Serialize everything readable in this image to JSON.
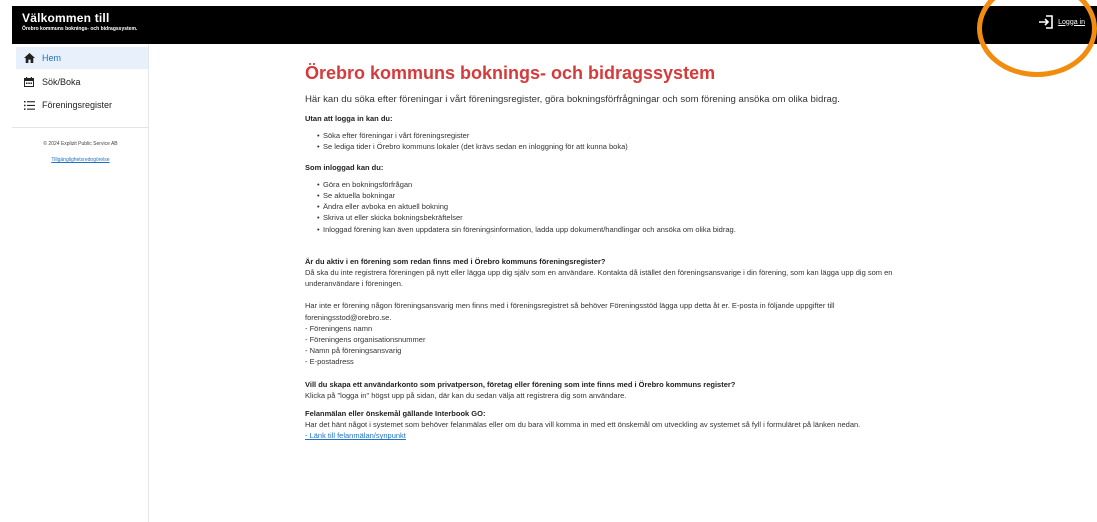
{
  "header": {
    "title": "Välkommen till",
    "subtitle": "Örebro kommuns boknings- och bidragssystem.",
    "login_label": "Logga in",
    "login_icon": "login-icon"
  },
  "colors": {
    "header_bg": "#000000",
    "accent": "#1e70c8",
    "title": "#d63a3a",
    "highlight": "#f28c0f"
  },
  "sidebar": {
    "items": [
      {
        "label": "Hem",
        "icon": "home-icon",
        "active": true
      },
      {
        "label": "Sök/Boka",
        "icon": "calendar-icon",
        "active": false
      },
      {
        "label": "Föreningsregister",
        "icon": "list-icon",
        "active": false
      }
    ],
    "copyright": "© 2024 Explizit Public Service AB",
    "privacy_link": "Tillgänglighetsredogörelse"
  },
  "main": {
    "title": "Örebro kommuns boknings- och bidragssystem",
    "intro": "Här kan du söka efter föreningar i vårt föreningsregister, göra bokningsförfrågningar och som förening ansöka om olika bidrag.",
    "without_login_heading": "Utan att logga in kan du:",
    "without_login_items": [
      "Söka efter föreningar i vårt föreningsregister",
      "Se lediga tider i Örebro kommuns lokaler (det krävs sedan en inloggning för att kunna boka)"
    ],
    "logged_in_heading": "Som inloggad kan du:",
    "logged_in_items": [
      "Göra en bokningsförfrågan",
      "Se aktuella bokningar",
      "Ändra eller avboka en aktuell bokning",
      "Skriva ut eller skicka bokningsbekräftelser",
      "Inloggad förening kan även uppdatera sin föreningsinformation, ladda upp dokument/handlingar och ansöka om olika bidrag."
    ],
    "active_heading": "Är du aktiv i en förening som redan finns med i Örebro kommuns föreningsregister?",
    "active_text": "Då ska du inte registrera föreningen på nytt eller lägga upp dig själv som en användare. Kontakta då istället den föreningsansvarige i din förening, som kan lägga upp dig som en underanvändare i föreningen.",
    "no_contact_text": "Har inte er förening någon föreningsansvarig men finns med i föreningsregistret så behöver Föreningsstöd lägga upp detta åt er. E-posta in följande uppgifter till foreningsstod@orebro.se.",
    "details_lines": [
      "- Föreningens namn",
      "- Föreningens organisationsnummer",
      "- Namn på föreningsansvarig",
      "- E-postadress"
    ],
    "create_heading": "Vill du skapa ett användarkonto som privatperson, företag eller förening som inte finns med i Örebro kommuns register?",
    "create_text": "Klicka på \"logga in\" högst upp på sidan, där kan du sedan välja att registrera dig som användare.",
    "report_heading": "Felanmälan eller önskemål gällande Interbook GO:",
    "report_text": "Har det hänt något i systemet som behöver felanmälas eller om du bara vill komma in med ett önskemål om utveckling av systemet så fyll i formuläret på länken nedan.",
    "report_link": "- Länk till felanmälan/synpunkt"
  }
}
